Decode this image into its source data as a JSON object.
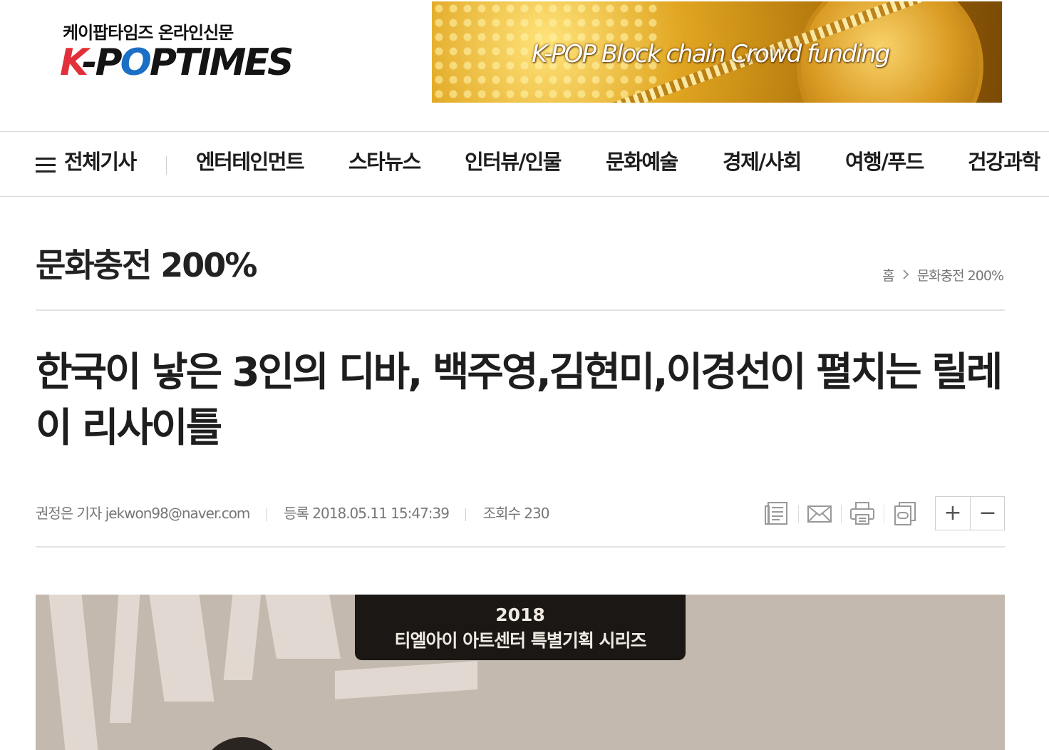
{
  "header": {
    "logo_subtitle": "케이팝타임즈 온라인신문",
    "logo_text": {
      "k": "K",
      "dash": "-",
      "p1": "P",
      "o1": "O",
      "p2": "P",
      "rest": "TIMES"
    },
    "banner_text": "K-POP Block chain Crowd funding"
  },
  "nav": {
    "all_articles": "전체기사",
    "items": [
      "엔터테인먼트",
      "스타뉴스",
      "인터뷰/인물",
      "문화예술",
      "경제/사회",
      "여행/푸드",
      "건강과학"
    ]
  },
  "section": {
    "title": "문화충전 200%",
    "breadcrumb_home": "홈",
    "breadcrumb_current": "문화충전 200%"
  },
  "article": {
    "headline": "한국이 낳은 3인의 디바, 백주영,김현미,이경선이 펼치는 릴레이 리사이틀",
    "author": "권정은 기자 jekwon98@naver.com",
    "registered": "등록 2018.05.11 15:47:39",
    "views": "조회수 230",
    "font_increase": "+",
    "font_decrease": "−",
    "image_caption_year": "2018",
    "image_caption_text": "티엘아이 아트센터 특별기획 시리즈"
  },
  "icons": [
    "menu-icon",
    "chevron-right-icon",
    "article-list-icon",
    "email-icon",
    "print-icon",
    "scrap-icon"
  ],
  "colors": {
    "brand_red": "#e2303a",
    "brand_blue": "#1b6fc4",
    "text": "#222222",
    "muted": "#777777"
  }
}
